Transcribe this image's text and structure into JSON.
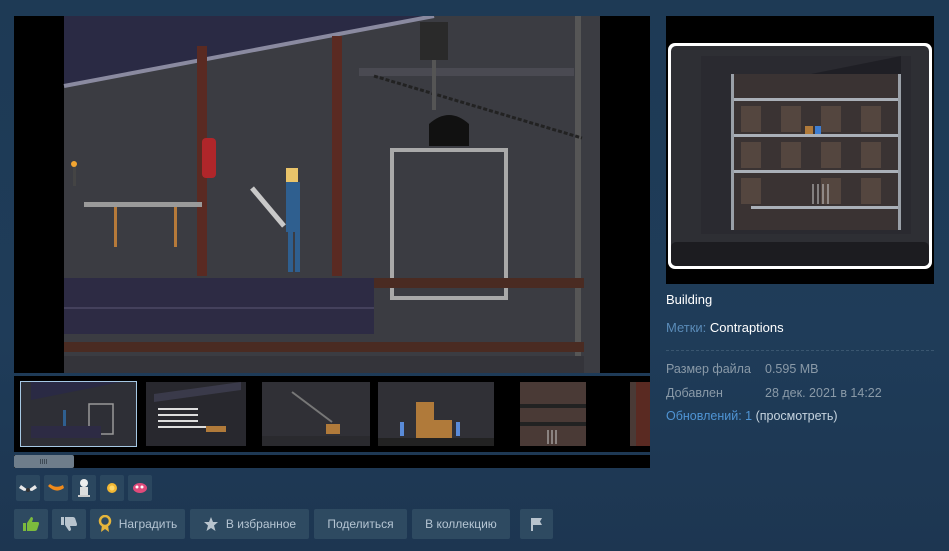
{
  "item": {
    "title": "Building",
    "tags_label": "Метки:",
    "tag": "Contraptions"
  },
  "details": {
    "size_label": "Размер файла",
    "size_value": "0.595 MB",
    "added_label": "Добавлен",
    "added_value": "28 дек. 2021 в 14:22",
    "updates_label": "Обновлений: 1",
    "updates_link": "(просмотреть)"
  },
  "buttons": {
    "award": "Наградить",
    "favorite": "В избранное",
    "share": "Поделиться",
    "collection": "В коллекцию"
  },
  "icons": {
    "thumbs_up": "thumbs-up-icon",
    "thumbs_down": "thumbs-down-icon",
    "award": "award-ribbon-icon",
    "favorite": "star-icon",
    "report": "flag-icon"
  },
  "colors": {
    "background": "#1e3a55",
    "accent": "#5a8bb8",
    "thumbs_up_green": "#7cba3d",
    "award_gold": "#e5b53b"
  }
}
